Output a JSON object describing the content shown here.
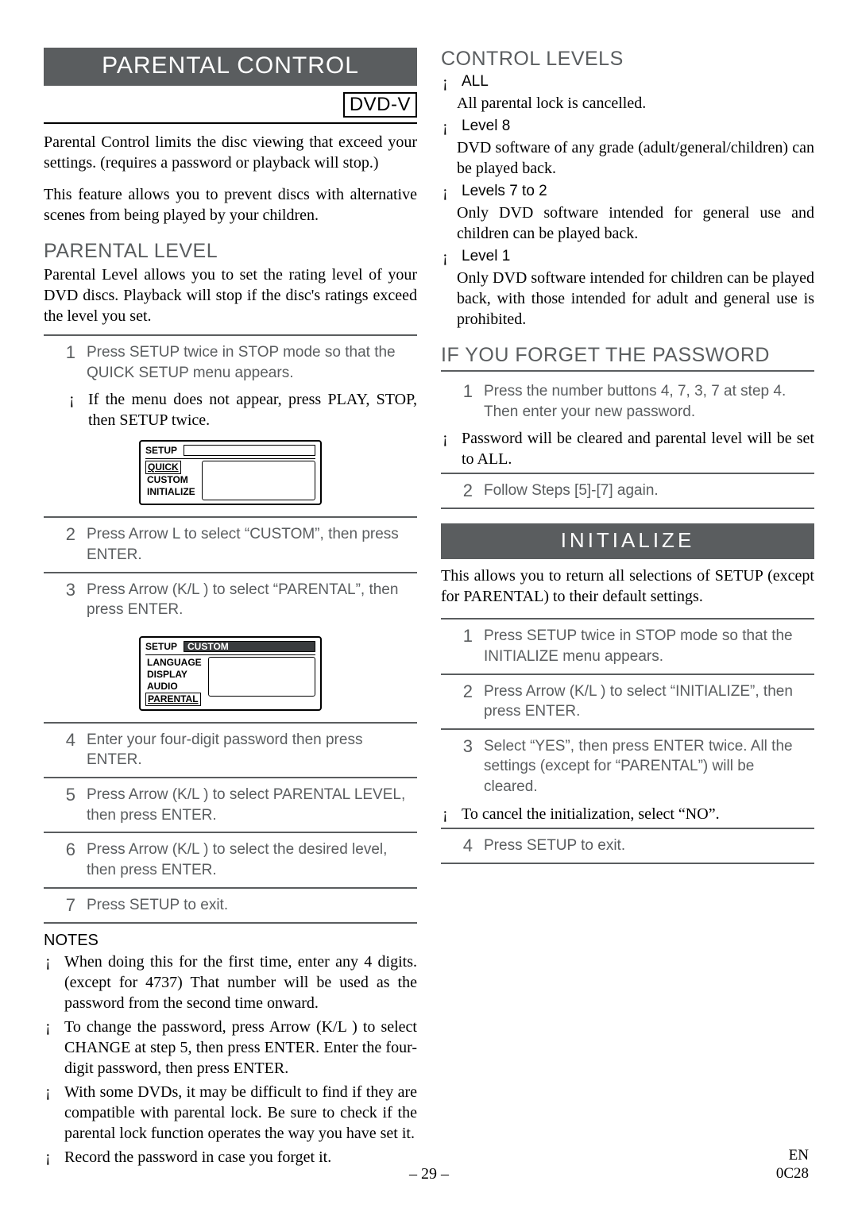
{
  "left": {
    "title": "PARENTAL CONTROL",
    "dvd_tag": "DVD-V",
    "intro1": "Parental Control limits the disc viewing that exceed your settings. (requires a password or playback will stop.)",
    "intro2": "This feature allows you to prevent discs with alternative scenes from being played by your children.",
    "section_head": "PARENTAL LEVEL",
    "section_body": "Parental Level allows you to set the rating level of your DVD discs. Playback will stop if the disc's ratings exceed the level you set.",
    "step1_num": "1",
    "step1": "Press SETUP twice in STOP mode so that the QUICK SETUP menu appears.",
    "step1_note": "If the menu does not appear, press PLAY, STOP, then SETUP twice.",
    "menu1": {
      "head": "SETUP",
      "i1": "QUICK",
      "i2": "CUSTOM",
      "i3": "INITIALIZE"
    },
    "step2_num": "2",
    "step2": "Press Arrow L to select “CUSTOM”, then press ENTER.",
    "step3_num": "3",
    "step3": "Press Arrow (K/L ) to select “PARENTAL”, then press ENTER.",
    "menu2": {
      "head": "SETUP",
      "sel": "CUSTOM",
      "i1": "LANGUAGE",
      "i2": "DISPLAY",
      "i3": "AUDIO",
      "i4": "PARENTAL"
    },
    "step4_num": "4",
    "step4": "Enter your four-digit password then press ENTER.",
    "step5_num": "5",
    "step5": "Press Arrow (K/L ) to select PARENTAL LEVEL, then press ENTER.",
    "step6_num": "6",
    "step6": "Press Arrow (K/L ) to select the desired level, then press ENTER.",
    "step7_num": "7",
    "step7": "Press SETUP to exit.",
    "notes_head": "NOTES",
    "note1": "When doing this for the first time, enter any 4 digits. (except for 4737) That number will be used as the password from the second time onward.",
    "note2": "To change the password, press Arrow (K/L ) to select CHANGE at step 5, then press ENTER. Enter the four-digit password, then press ENTER.",
    "note3": "With some DVDs, it may be difficult to find if they are compatible with parental lock. Be sure to check if the parental lock function operates the way you have set it.",
    "note4": "Record the password in case you forget it."
  },
  "right": {
    "section_head": "CONTROL LEVELS",
    "l0_head": "ALL",
    "l0_body": "All parental lock is cancelled.",
    "l1_head": "Level 8",
    "l1_body": "DVD software of any grade (adult/general/children) can be played back.",
    "l2_head": "Levels 7 to 2",
    "l2_body": "Only DVD software intended for general use and children can be played back.",
    "l3_head": "Level 1",
    "l3_body": "Only DVD software intended for children can be played back, with those intended for adult and general use is prohibited.",
    "forget_head": "IF YOU FORGET THE PASSWORD",
    "fstep1_num": "1",
    "fstep1": "Press the number buttons 4, 7, 3, 7 at step 4. Then enter your new password.",
    "fnote": "Password will be cleared and parental level will be set to ALL.",
    "fstep2_num": "2",
    "fstep2": "Follow Steps [5]-[7] again.",
    "init_title": "INITIALIZE",
    "init_body": "This allows you to return all selections of SETUP (except for PARENTAL) to their default settings.",
    "istep1_num": "1",
    "istep1": "Press SETUP twice in STOP mode so that the INITIALIZE menu appears.",
    "istep2_num": "2",
    "istep2": "Press Arrow (K/L ) to select “INITIALIZE”, then press ENTER.",
    "istep3_num": "3",
    "istep3": "Select “YES”, then press ENTER twice. All the settings (except for “PARENTAL”) will be cleared.",
    "inote": "To cancel the initialization, select “NO”.",
    "istep4_num": "4",
    "istep4": "Press SETUP to exit."
  },
  "footer": {
    "page": "– 29 –",
    "code1": "EN",
    "code2": "0C28"
  }
}
